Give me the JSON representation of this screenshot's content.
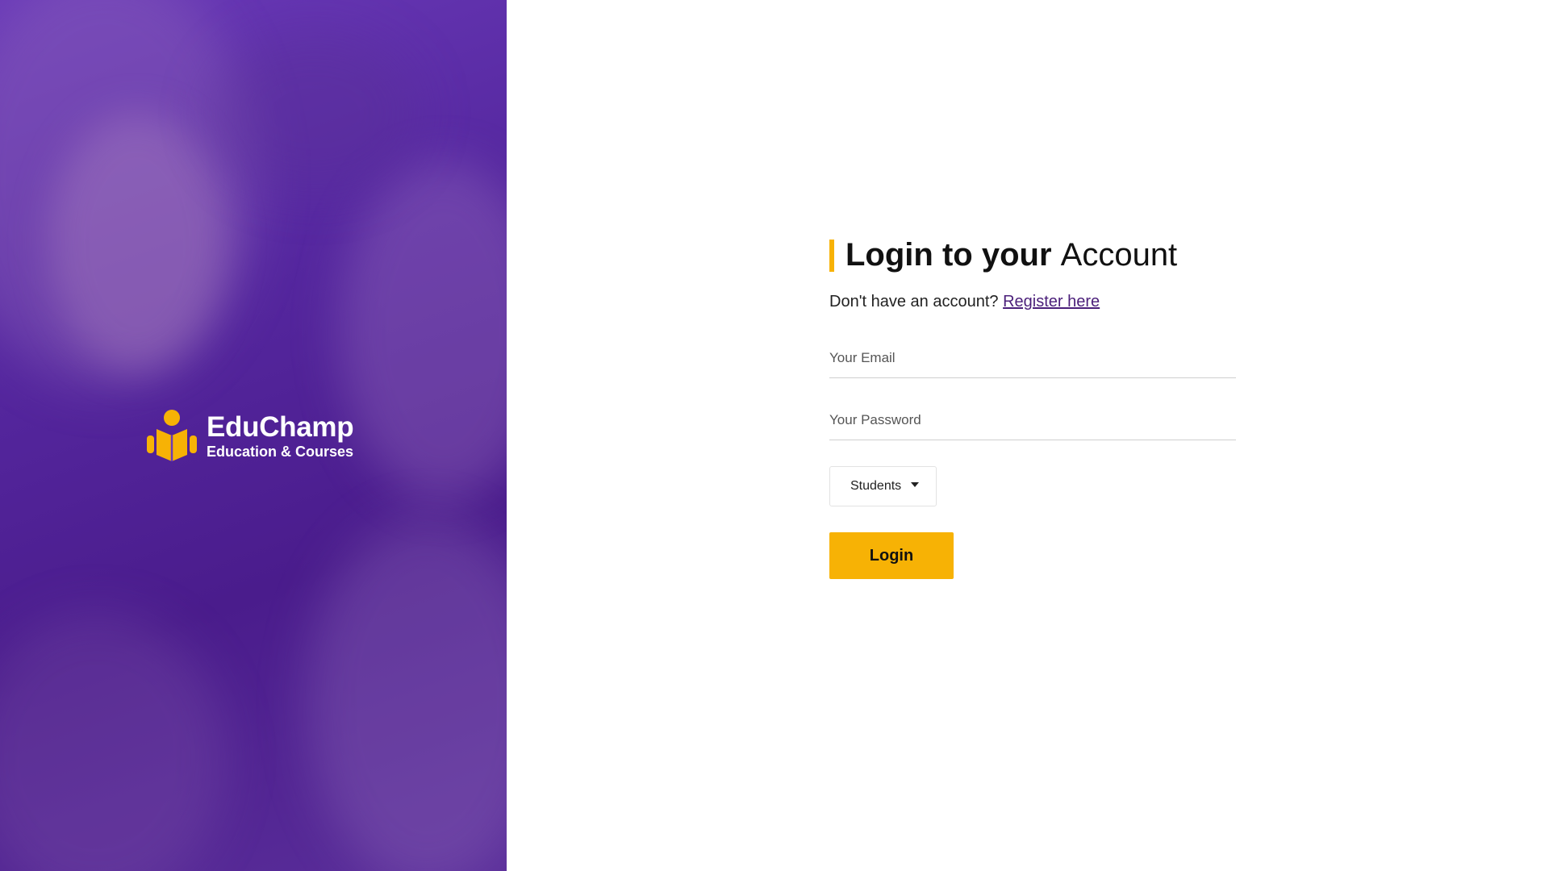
{
  "brand": {
    "name": "EduChamp",
    "tagline": "Education & Courses",
    "logo_icon": "reading-person-icon"
  },
  "login": {
    "title_bold": "Login to your",
    "title_light": "Account",
    "register_prompt": "Don't have an account?",
    "register_link": "Register here",
    "email_placeholder": "Your Email",
    "password_placeholder": "Your Password",
    "role_selected": "Students",
    "submit_label": "Login"
  },
  "colors": {
    "accent": "#f7b205",
    "hero_purple": "#55279f",
    "link": "#4b1f7a"
  }
}
